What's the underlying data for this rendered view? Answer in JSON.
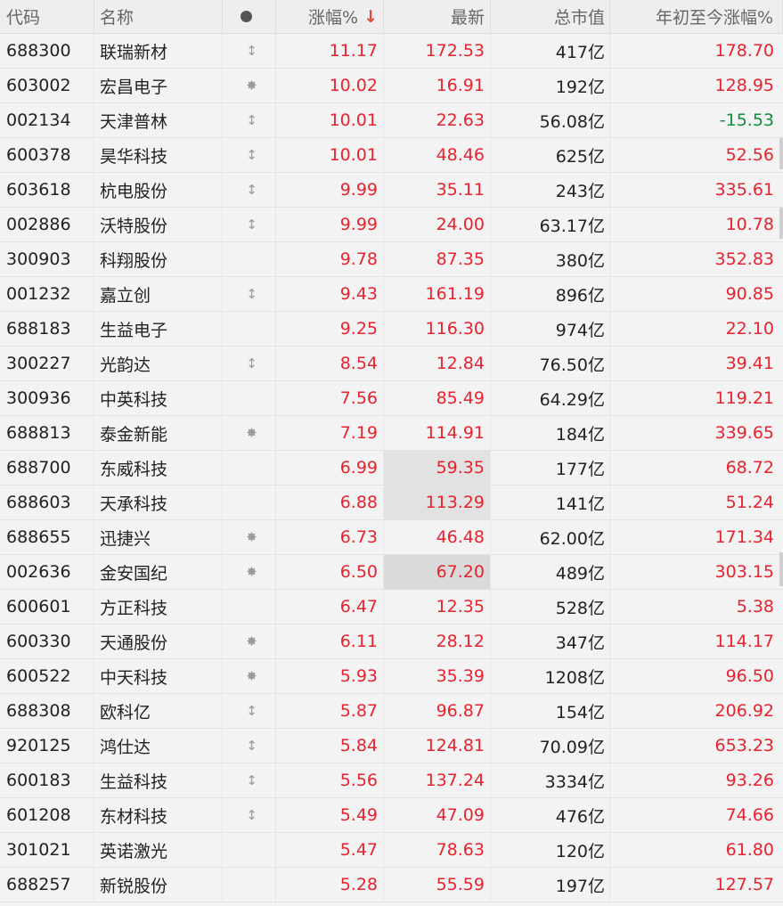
{
  "header": {
    "code": "代码",
    "name": "名称",
    "pct": "涨幅%",
    "sort_arrow": "↓",
    "last": "最新",
    "cap": "总市值",
    "ytd": "年初至今涨幅%"
  },
  "rows": [
    {
      "code": "688300",
      "name": "联瑞新材",
      "mark": "↕",
      "pct": "11.17",
      "last": "172.53",
      "cap": "417亿",
      "ytd": "178.70",
      "ytd_dir": "up"
    },
    {
      "code": "603002",
      "name": "宏昌电子",
      "mark": "✸",
      "pct": "10.02",
      "last": "16.91",
      "cap": "192亿",
      "ytd": "128.95",
      "ytd_dir": "up"
    },
    {
      "code": "002134",
      "name": "天津普林",
      "mark": "↕",
      "pct": "10.01",
      "last": "22.63",
      "cap": "56.08亿",
      "ytd": "-15.53",
      "ytd_dir": "down"
    },
    {
      "code": "600378",
      "name": "昊华科技",
      "mark": "↕",
      "pct": "10.01",
      "last": "48.46",
      "cap": "625亿",
      "ytd": "52.56",
      "ytd_dir": "up"
    },
    {
      "code": "603618",
      "name": "杭电股份",
      "mark": "↕",
      "pct": "9.99",
      "last": "35.11",
      "cap": "243亿",
      "ytd": "335.61",
      "ytd_dir": "up"
    },
    {
      "code": "002886",
      "name": "沃特股份",
      "mark": "↕",
      "pct": "9.99",
      "last": "24.00",
      "cap": "63.17亿",
      "ytd": "10.78",
      "ytd_dir": "up"
    },
    {
      "code": "300903",
      "name": "科翔股份",
      "mark": "",
      "pct": "9.78",
      "last": "87.35",
      "cap": "380亿",
      "ytd": "352.83",
      "ytd_dir": "up"
    },
    {
      "code": "001232",
      "name": "嘉立创",
      "mark": "↕",
      "pct": "9.43",
      "last": "161.19",
      "cap": "896亿",
      "ytd": "90.85",
      "ytd_dir": "up"
    },
    {
      "code": "688183",
      "name": "生益电子",
      "mark": "",
      "pct": "9.25",
      "last": "116.30",
      "cap": "974亿",
      "ytd": "22.10",
      "ytd_dir": "up"
    },
    {
      "code": "300227",
      "name": "光韵达",
      "mark": "↕",
      "pct": "8.54",
      "last": "12.84",
      "cap": "76.50亿",
      "ytd": "39.41",
      "ytd_dir": "up"
    },
    {
      "code": "300936",
      "name": "中英科技",
      "mark": "",
      "pct": "7.56",
      "last": "85.49",
      "cap": "64.29亿",
      "ytd": "119.21",
      "ytd_dir": "up"
    },
    {
      "code": "688813",
      "name": "泰金新能",
      "mark": "✸",
      "pct": "7.19",
      "last": "114.91",
      "cap": "184亿",
      "ytd": "339.65",
      "ytd_dir": "up"
    },
    {
      "code": "688700",
      "name": "东威科技",
      "mark": "",
      "pct": "6.99",
      "last": "59.35",
      "cap": "177亿",
      "ytd": "68.72",
      "ytd_dir": "up",
      "flash": 1
    },
    {
      "code": "688603",
      "name": "天承科技",
      "mark": "",
      "pct": "6.88",
      "last": "113.29",
      "cap": "141亿",
      "ytd": "51.24",
      "ytd_dir": "up",
      "flash": 1
    },
    {
      "code": "688655",
      "name": "迅捷兴",
      "mark": "✸",
      "pct": "6.73",
      "last": "46.48",
      "cap": "62.00亿",
      "ytd": "171.34",
      "ytd_dir": "up"
    },
    {
      "code": "002636",
      "name": "金安国纪",
      "mark": "✸",
      "pct": "6.50",
      "last": "67.20",
      "cap": "489亿",
      "ytd": "303.15",
      "ytd_dir": "up",
      "flash": 2
    },
    {
      "code": "600601",
      "name": "方正科技",
      "mark": "",
      "pct": "6.47",
      "last": "12.35",
      "cap": "528亿",
      "ytd": "5.38",
      "ytd_dir": "up"
    },
    {
      "code": "600330",
      "name": "天通股份",
      "mark": "✸",
      "pct": "6.11",
      "last": "28.12",
      "cap": "347亿",
      "ytd": "114.17",
      "ytd_dir": "up"
    },
    {
      "code": "600522",
      "name": "中天科技",
      "mark": "✸",
      "pct": "5.93",
      "last": "35.39",
      "cap": "1208亿",
      "ytd": "96.50",
      "ytd_dir": "up"
    },
    {
      "code": "688308",
      "name": "欧科亿",
      "mark": "↕",
      "pct": "5.87",
      "last": "96.87",
      "cap": "154亿",
      "ytd": "206.92",
      "ytd_dir": "up"
    },
    {
      "code": "920125",
      "name": "鸿仕达",
      "mark": "↕",
      "pct": "5.84",
      "last": "124.81",
      "cap": "70.09亿",
      "ytd": "653.23",
      "ytd_dir": "up"
    },
    {
      "code": "600183",
      "name": "生益科技",
      "mark": "↕",
      "pct": "5.56",
      "last": "137.24",
      "cap": "3334亿",
      "ytd": "93.26",
      "ytd_dir": "up"
    },
    {
      "code": "601208",
      "name": "东材科技",
      "mark": "↕",
      "pct": "5.49",
      "last": "47.09",
      "cap": "476亿",
      "ytd": "74.66",
      "ytd_dir": "up"
    },
    {
      "code": "301021",
      "name": "英诺激光",
      "mark": "",
      "pct": "5.47",
      "last": "78.63",
      "cap": "120亿",
      "ytd": "61.80",
      "ytd_dir": "up"
    },
    {
      "code": "688257",
      "name": "新锐股份",
      "mark": "",
      "pct": "5.28",
      "last": "55.59",
      "cap": "197亿",
      "ytd": "127.57",
      "ytd_dir": "up"
    }
  ]
}
